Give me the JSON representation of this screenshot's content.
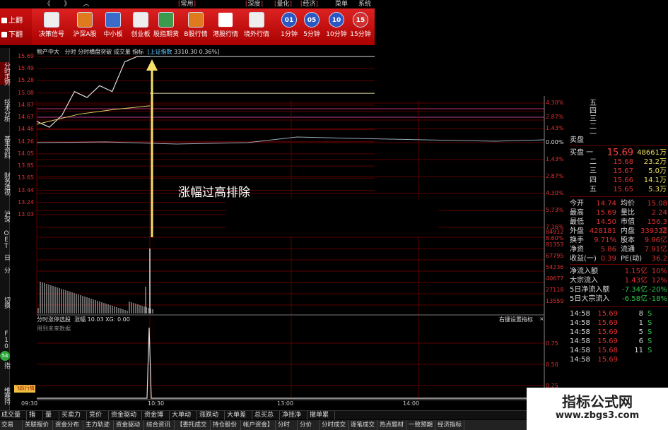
{
  "topbar": {
    "back": "《",
    "forward": "》",
    "up": "︿",
    "menu": [
      "常用",
      "深度",
      "量化",
      "经济",
      "菜单",
      "系统"
    ]
  },
  "pager": {
    "prev": "上翻",
    "next": "下翻"
  },
  "toolbar": [
    {
      "label": "决策信号",
      "icon": "decision-signal-icon"
    },
    {
      "label": "沪深A股",
      "icon": "a-share-icon"
    },
    {
      "label": "中小板",
      "icon": "sme-board-icon"
    },
    {
      "label": "创业板",
      "icon": "gem-board-icon"
    },
    {
      "label": "股指期货",
      "icon": "index-futures-icon"
    },
    {
      "label": "B股行情",
      "icon": "b-share-icon"
    },
    {
      "label": "港股行情",
      "icon": "hk-stock-icon"
    },
    {
      "label": "境外行情",
      "icon": "overseas-icon"
    },
    {
      "label": "1分钟",
      "icon": "1-min-icon",
      "num": "01"
    },
    {
      "label": "5分钟",
      "icon": "5-min-icon",
      "num": "05"
    },
    {
      "label": "10分钟",
      "icon": "10-min-icon",
      "num": "10"
    },
    {
      "label": "15分钟",
      "icon": "15-min-icon",
      "num": "15"
    }
  ],
  "vtabs": [
    "分时走势",
    "技术分析",
    "基本资料",
    "财务透视",
    "沪深",
    "OET",
    "日",
    "分",
    "切换",
    "F10",
    "指"
  ],
  "vtab_bottom": "维赛持",
  "chart_header": {
    "stock": "物产中大",
    "items": "分时  分时横盘突破  成交量  指标",
    "index_name": "[上证指数",
    "index_value": "3310.30 0.36%]"
  },
  "price_axis": [
    "15.69",
    "15.49",
    "15.28",
    "15.08",
    "14.87",
    "14.67",
    "14.46",
    "14.26",
    "14.05",
    "13.85",
    "13.65",
    "13.44",
    "13.24",
    "13.03"
  ],
  "pct_axis": [
    "4.30%",
    "2.87%",
    "1.43%",
    "0.00%",
    "1.43%",
    "2.87%",
    "4.30%",
    "5.73%",
    "7.16%",
    "8.60%"
  ],
  "vol_axis": [
    "84912",
    "81353",
    "67795",
    "54236",
    "40677",
    "27118",
    "13559"
  ],
  "sub_axis": [
    "0.75",
    "0.50",
    "0.25",
    "0.00"
  ],
  "annotation": "涨幅过高排除",
  "sub_header": {
    "name": "分时涨停选股",
    "items": "涨幅 10.03  XG: 0.00",
    "note": "用到未来数据",
    "right": "右键设置指标",
    "close": "×"
  },
  "badge": "飞跃行情",
  "time_axis": [
    "09:30",
    "10:30",
    "13:00",
    "14:00"
  ],
  "right_panel": {
    "sell": {
      "label": "卖盘",
      "levels": [
        "五",
        "四",
        "三",
        "二",
        "一"
      ]
    },
    "buy": [
      {
        "label": "买盘 一",
        "price": "15.69",
        "vol": "48661万"
      },
      {
        "label": "二",
        "price": "15.68",
        "vol": "23.2万"
      },
      {
        "label": "三",
        "price": "15.67",
        "vol": "5.0万"
      },
      {
        "label": "四",
        "price": "15.66",
        "vol": "14.1万"
      },
      {
        "label": "五",
        "price": "15.65",
        "vol": "5.3万"
      }
    ],
    "stats": [
      [
        "今开",
        "14.74",
        "均价",
        "15.08"
      ],
      [
        "最高",
        "15.69",
        "量比",
        "2.24"
      ],
      [
        "最低",
        "14.50",
        "市值",
        "156.3亿"
      ],
      [
        "外盘",
        "428181",
        "内盘",
        "339322"
      ],
      [
        "换手",
        "9.71%",
        "股本",
        "9.96亿"
      ],
      [
        "净资",
        "5.86",
        "流通",
        "7.91亿"
      ],
      [
        "收益(一)",
        "0.39",
        "PE(动)",
        "36.2"
      ]
    ],
    "flows": [
      [
        "净流入额",
        "1.15亿",
        "10%"
      ],
      [
        "大宗流入",
        "1.43亿",
        "12%"
      ],
      [
        "5日净流入额",
        "-7.34亿",
        "-20%"
      ],
      [
        "5日大宗流入",
        "-6.58亿",
        "-18%"
      ]
    ],
    "ticks": [
      [
        "14:58",
        "15.69",
        "8",
        "S"
      ],
      [
        "14:58",
        "15.69",
        "1",
        "S"
      ],
      [
        "14:58",
        "15.69",
        "5",
        "S"
      ],
      [
        "14:58",
        "15.69",
        "6",
        "S"
      ],
      [
        "14:58",
        "15.68",
        "11",
        "S"
      ],
      [
        "14:58",
        "15.69",
        "",
        ""
      ]
    ]
  },
  "tabs_row1": [
    "成交量",
    "指标",
    "量比",
    "买卖力道",
    "竞价图",
    "资金驱动力",
    "资金博弈",
    "大单动向",
    "涨跌动因",
    "大单差分",
    "总买总卖",
    "净挂净撤",
    "撤单累计"
  ],
  "tabs_row2": [
    "交易",
    "关联报价",
    "资金分布",
    "主力轨迹",
    "资金驱动",
    "综合资讯",
    "【委托成交",
    "持仓股份",
    "帐户资金】",
    "分时图",
    "分价图",
    "分时成交",
    "逐笔成交",
    "热点题材",
    "一致预期",
    "经济指标"
  ],
  "watermark": {
    "title": "指标公式网",
    "url": "www.zbgs3.com"
  },
  "chart_data": {
    "type": "line",
    "x": [
      "09:30",
      "10:30",
      "13:00",
      "14:00"
    ],
    "ylim": [
      13.03,
      15.69
    ],
    "series": [
      {
        "values": [
          14.6,
          14.5,
          14.7,
          15.1,
          15.0,
          15.2,
          15.1,
          15.6,
          15.69,
          15.69
        ]
      }
    ]
  },
  "colors": {
    "up": "#e03030",
    "down": "#2fc84a",
    "grid": "#5a0000",
    "toolbar": "#c41a1a",
    "arrow": "#f5e06a"
  }
}
